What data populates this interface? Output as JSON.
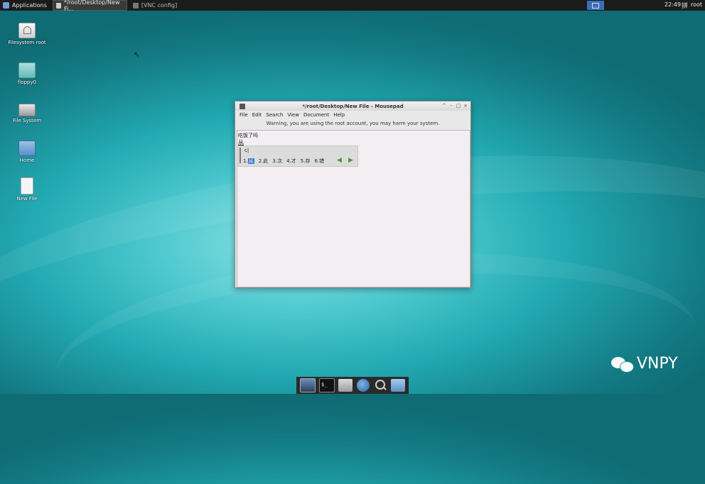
{
  "top_panel": {
    "applications_label": "Applications",
    "tasks": [
      {
        "label": "*/root/Desktop/New Fi...",
        "active": true
      },
      {
        "label": "[VNC config]",
        "active": false
      }
    ],
    "clock": "22:49",
    "keyboard_indicator": "拼",
    "user": "root"
  },
  "desktop_icons": [
    {
      "label": "Filesystem root",
      "icon": "drive-icon"
    },
    {
      "label": "floppy0",
      "icon": "floppy-icon"
    },
    {
      "label": "File System",
      "icon": "filesystem-icon"
    },
    {
      "label": "Home",
      "icon": "home-folder-icon"
    },
    {
      "label": "New File",
      "icon": "file-icon"
    }
  ],
  "window": {
    "title": "*/root/Desktop/New File - Mousepad",
    "controls": [
      "^",
      "-",
      "□",
      "×"
    ],
    "menu": [
      "File",
      "Edit",
      "Search",
      "View",
      "Document",
      "Help"
    ],
    "warning": "Warning, you are using the root account, you may harm your system.",
    "editor": {
      "line1": "吃饭了吗",
      "line2": "从"
    },
    "ime": {
      "preedit": "c|",
      "candidates": [
        {
          "index": "1.",
          "text": "从",
          "selected": true
        },
        {
          "index": "2.",
          "text": "此",
          "selected": false
        },
        {
          "index": "3.",
          "text": "次",
          "selected": false
        },
        {
          "index": "4.",
          "text": "才",
          "selected": false
        },
        {
          "index": "5.",
          "text": "存",
          "selected": false
        },
        {
          "index": "6.",
          "text": "错",
          "selected": false
        }
      ],
      "prev_icon": "arrow-left-icon",
      "next_icon": "arrow-right-icon"
    }
  },
  "dock": [
    "show-desktop-icon",
    "terminal-icon",
    "file-manager-icon",
    "web-browser-icon",
    "app-finder-icon",
    "folder-icon"
  ],
  "dock_terminal_glyph": "$_",
  "watermark": {
    "text": "VNPY",
    "icon": "wechat-icon"
  }
}
